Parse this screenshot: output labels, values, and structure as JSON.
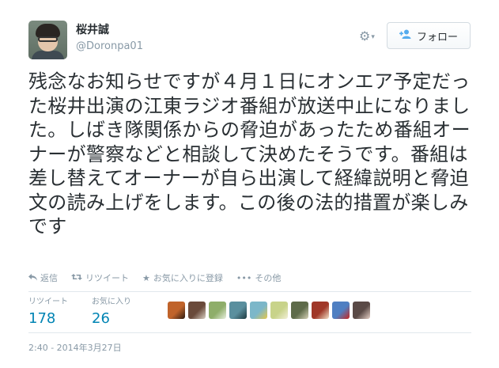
{
  "user": {
    "display_name": "桜井誠",
    "handle": "@Doronpa01"
  },
  "header": {
    "gear_icon": "gear-icon",
    "gear_caret": "▾",
    "follow_label": "フォロー"
  },
  "tweet": {
    "text": "残念なお知らせですが４月１日にオンエア予定だった桜井出演の江東ラジオ番組が放送中止になりました。しばき隊関係からの脅迫があったため番組オーナーが警察などと相談して決めたそうです。番組は差し替えてオーナーが自ら出演して経緯説明と脅迫文の読み上げをします。この後の法的措置が楽しみです"
  },
  "actions": {
    "reply": "返信",
    "retweet": "リツイート",
    "favorite": "お気に入りに登録",
    "more": "その他"
  },
  "stats": {
    "retweets_label": "リツイート",
    "retweets_value": "178",
    "favorites_label": "お気に入り",
    "favorites_value": "26"
  },
  "favoriters": [
    {
      "color": "#c0632a",
      "color2": "#2b1a10"
    },
    {
      "color": "#6a4a3a",
      "color2": "#d9d0c4"
    },
    {
      "color": "#8fae6a",
      "color2": "#e8efe0"
    },
    {
      "color": "#5a8f9e",
      "color2": "#1e3a3f"
    },
    {
      "color": "#7cb7c9",
      "color2": "#e6c84a"
    },
    {
      "color": "#c8d38a",
      "color2": "#f3f0d8"
    },
    {
      "color": "#5e6b4a",
      "color2": "#d6d2b8"
    },
    {
      "color": "#a03828",
      "color2": "#f2e2c8"
    },
    {
      "color": "#4f7fc2",
      "color2": "#c8261f"
    },
    {
      "color": "#5a4a46",
      "color2": "#e6d0c6"
    }
  ],
  "timestamp": "2:40 - 2014年3月27日"
}
